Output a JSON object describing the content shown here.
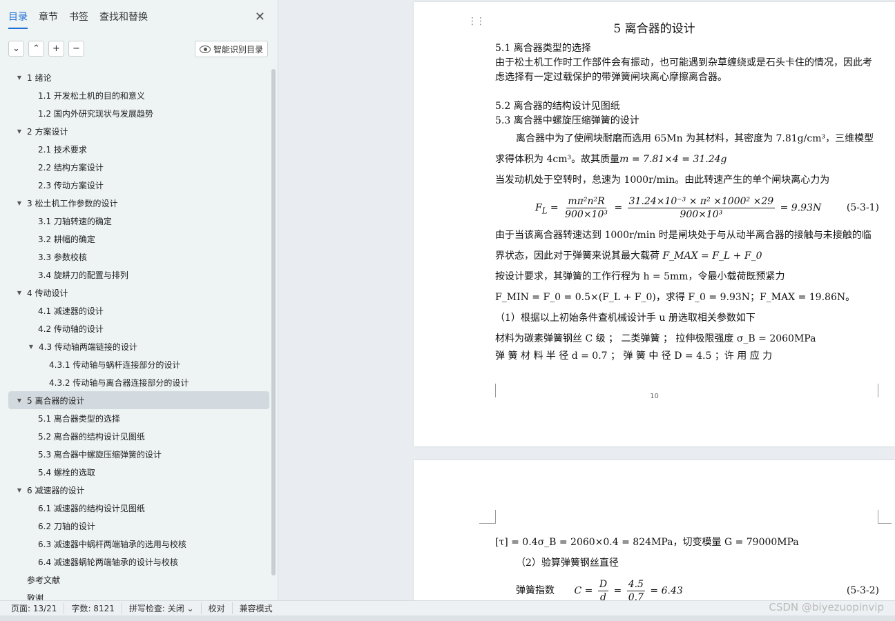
{
  "nav": {
    "tabs": [
      "目录",
      "章节",
      "书签",
      "查找和替换"
    ],
    "close_symbol": "✕",
    "tools": [
      "⌄",
      "⌃",
      "+",
      "−"
    ],
    "smart_button": "智能识别目录",
    "toc": [
      {
        "level": 1,
        "arrow": true,
        "label": "1  绪论"
      },
      {
        "level": 2,
        "label": "1.1   开发松土机的目的和意义"
      },
      {
        "level": 2,
        "label": "1.2   国内外研究现状与发展趋势"
      },
      {
        "level": 1,
        "arrow": true,
        "label": "2   方案设计"
      },
      {
        "level": 2,
        "label": "2.1   技术要求"
      },
      {
        "level": 2,
        "label": "2.2   结构方案设计"
      },
      {
        "level": 2,
        "label": "2.3   传动方案设计"
      },
      {
        "level": 1,
        "arrow": true,
        "label": "3  松土机工作参数的设计"
      },
      {
        "level": 2,
        "label": "3.1   刀轴转速的确定"
      },
      {
        "level": 2,
        "label": "3.2   耕幅的确定"
      },
      {
        "level": 2,
        "label": "3.3   参数校核"
      },
      {
        "level": 2,
        "label": "3.4   旋耕刀的配置与排列"
      },
      {
        "level": 1,
        "arrow": true,
        "label": "4  传动设计"
      },
      {
        "level": 2,
        "label": "4.1   减速器的设计"
      },
      {
        "level": 2,
        "label": "4.2   传动轴的设计"
      },
      {
        "level": 2,
        "arrow": true,
        "label": "4.3   传动轴两端链接的设计"
      },
      {
        "level": 3,
        "label": "4.3.1  传动轴与蜗杆连接部分的设计"
      },
      {
        "level": 3,
        "label": "4.3.2 传动轴与离合器连接部分的设计"
      },
      {
        "level": 1,
        "arrow": true,
        "selected": true,
        "label": "5  离合器的设计"
      },
      {
        "level": 2,
        "label": "5.1   离合器类型的选择"
      },
      {
        "level": 2,
        "label": "5.2   离合器的结构设计见图纸"
      },
      {
        "level": 2,
        "label": "5.3   离合器中螺旋压缩弹簧的设计"
      },
      {
        "level": 2,
        "label": "5.4   螺栓的选取"
      },
      {
        "level": 1,
        "arrow": true,
        "label": "6  减速器的设计"
      },
      {
        "level": 2,
        "label": "6.1  减速器的结构设计见图纸"
      },
      {
        "level": 2,
        "label": "6.2  刀轴的设计"
      },
      {
        "level": 2,
        "label": "6.3   减速器中蜗杆两端轴承的选用与校核"
      },
      {
        "level": 2,
        "label": "6.4   减速器蜗轮两端轴承的设计与校核"
      },
      {
        "level": 1,
        "arrow": false,
        "label": "参考文献"
      },
      {
        "level": 1,
        "arrow": false,
        "label": "致谢"
      }
    ]
  },
  "doc": {
    "title": "5  离合器的设计",
    "s51": "5.1   离合器类型的选择",
    "p1": "由于松土机工作时工作部件会有振动，也可能遇到杂草缠绕或是石头卡住的情况，因此考虑选择有一定过载保护的带弹簧闸块离心摩擦离合器。",
    "s52": "5.2   离合器的结构设计见图纸",
    "s53": "5.3   离合器中螺旋压缩弹簧的设计",
    "p2a": "离合器中为了使闸块耐磨而选用 65Mn 为其材料，其密度为 7.81g/cm³，三维模型求得体积为 4cm³。故其质量",
    "p2b": "m = 7.81×4 = 31.24g",
    "p3": "当发动机处于空转时，怠速为 1000r/min。由此转速产生的单个闸块离心力为",
    "eq1_lhs": "F",
    "eq1_lhs_sub": "L",
    "eq1_f1_num": "mπ²n²R",
    "eq1_f1_den": "900×10³",
    "eq1_f2_num": "31.24×10⁻³ × π² ×1000² ×29",
    "eq1_f2_den": "900×10³",
    "eq1_result": "= 9.93N",
    "eq1_no": "(5-3-1)",
    "p4": "由于当该离合器转速达到 1000r/min 时是闸块处于与从动半离合器的接触与未接触的临界状态，因此对于弹簧来说其最大载荷",
    "p4_math": "F_MAX = F_L + F_0",
    "p5": "按设计要求，其弹簧的工作行程为 h = 5mm，令最小载荷既预紧力",
    "p5_math": "F_MIN = F_0 = 0.5×(F_L + F_0)，求得 F_0 = 9.93N；F_MAX = 19.86N。",
    "p6": "（1）根据以上初始条件查机械设计手 u 册选取相关参数如下",
    "p7": "材料为碳素弹簧钢丝 C 级 ；  二类弹簧 ；  拉伸极限强度   σ_B = 2060MPa",
    "p8": "弹 簧 材 料 半 径    d = 0.7      ；   弹 簧 中 径   D = 4.5    ；许 用 应 力",
    "page_num": "10",
    "p9": "[τ] = 0.4σ_B = 2060×0.4 = 824MPa，切变模量  G = 79000MPa",
    "p10": "（2）验算弹簧钢丝直径",
    "p11_label": "弹簧指数",
    "eq2_lhs": "C =",
    "eq2_num": "D",
    "eq2_den": "d",
    "eq2_num2": "4.5",
    "eq2_den2": "0.7",
    "eq2_result": "= 6.43",
    "eq2_no": "(5-3-2)"
  },
  "status": {
    "page": "页面: 13/21",
    "words": "字数: 8121",
    "spell": "拼写检查: 关闭 ⌄",
    "proof": "校对",
    "compat": "兼容模式"
  },
  "watermark": "CSDN @biyezuopinvip",
  "colors": {
    "accent": "#1f6fd8",
    "selected_bg": "#d3dadf"
  }
}
